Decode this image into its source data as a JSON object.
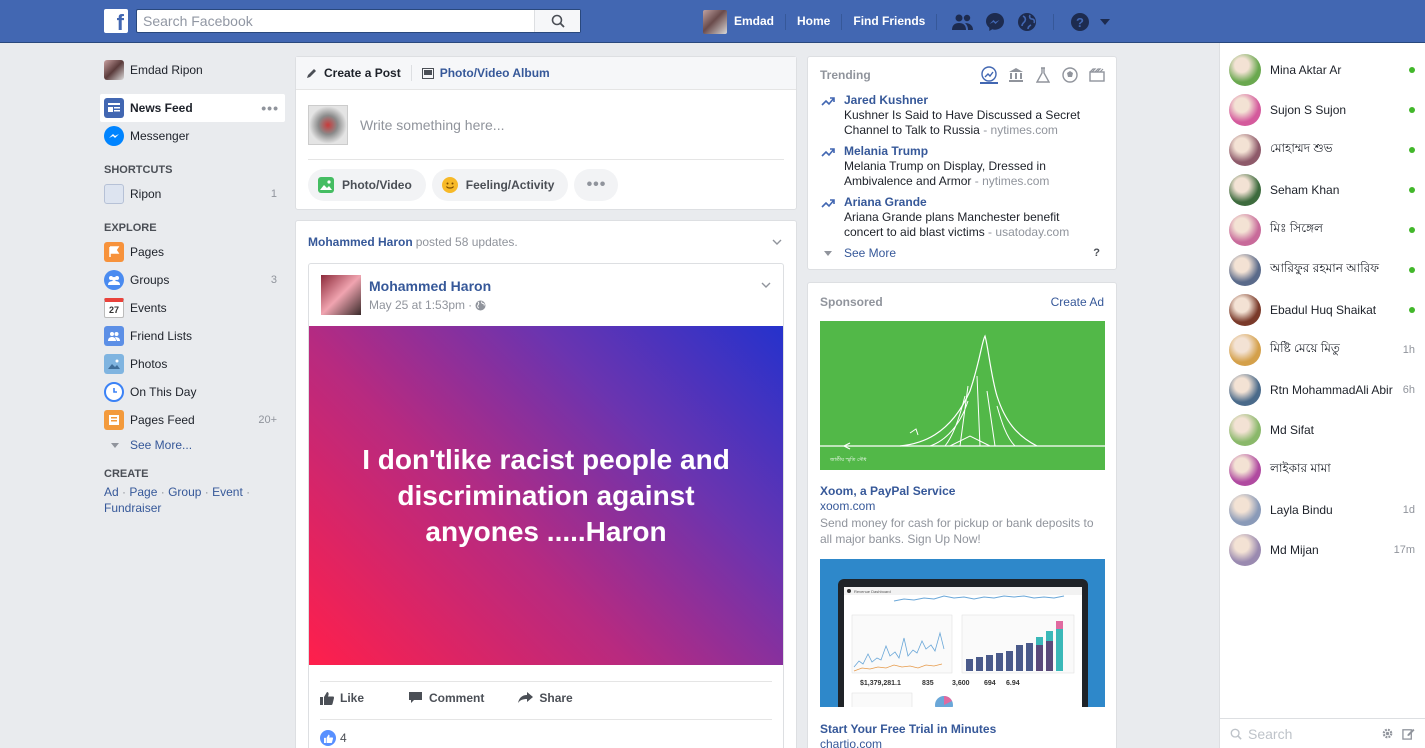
{
  "topbar": {
    "logo": "f",
    "search_placeholder": "Search Facebook",
    "user_name": "Emdad",
    "home": "Home",
    "find_friends": "Find Friends",
    "brand_color": "#4267b2"
  },
  "leftnav": {
    "profile": "Emdad Ripon",
    "news_feed": "News Feed",
    "messenger": "Messenger",
    "shortcuts_heading": "SHORTCUTS",
    "shortcuts": [
      {
        "label": "Ripon",
        "count": "1"
      }
    ],
    "explore_heading": "EXPLORE",
    "explore": [
      {
        "label": "Pages",
        "count": "",
        "icon": "flag-icon"
      },
      {
        "label": "Groups",
        "count": "3",
        "icon": "groups-icon"
      },
      {
        "label": "Events",
        "count": "",
        "icon": "calendar-icon",
        "icon_text": "27"
      },
      {
        "label": "Friend Lists",
        "count": "",
        "icon": "friend-list-icon"
      },
      {
        "label": "Photos",
        "count": "",
        "icon": "photos-icon"
      },
      {
        "label": "On This Day",
        "count": "",
        "icon": "clock-icon"
      },
      {
        "label": "Pages Feed",
        "count": "20+",
        "icon": "pages-feed-icon"
      }
    ],
    "see_more": "See More...",
    "create_heading": "CREATE",
    "create_links": [
      "Ad",
      "Page",
      "Group",
      "Event",
      "Fundraiser"
    ],
    "create_sep": " · "
  },
  "composer": {
    "tab_create": "Create a Post",
    "tab_album": "Photo/Video Album",
    "placeholder": "Write something here...",
    "photo_video": "Photo/Video",
    "feeling": "Feeling/Activity"
  },
  "post": {
    "header_name": "Mohammed Haron",
    "header_text": "posted 58 updates.",
    "author": "Mohammed Haron",
    "time": "May 25 at 1:53pm",
    "dot": "·",
    "banner_text": "I don'tlike racist people and discrimination against anyones .....Haron",
    "like": "Like",
    "comment": "Comment",
    "share": "Share",
    "like_count": "4"
  },
  "trending": {
    "title": "Trending",
    "items": [
      {
        "topic": "Jared Kushner",
        "desc": "Kushner Is Said to Have Discussed a Secret Channel to Talk to Russia",
        "source": "nytimes.com"
      },
      {
        "topic": "Melania Trump",
        "desc": "Melania Trump on Display, Dressed in Ambivalence and Armor",
        "source": "nytimes.com"
      },
      {
        "topic": "Ariana Grande",
        "desc": "Ariana Grande plans Manchester benefit concert to aid blast victims",
        "source": "usatoday.com"
      }
    ],
    "sep": " - ",
    "see_more": "See More",
    "help": "?"
  },
  "sponsored": {
    "title": "Sponsored",
    "create_ad": "Create Ad",
    "ad1_caption": "জাতীয় স্মৃতি সৌধ",
    "ad1_title": "Xoom, a PayPal Service",
    "ad1_domain": "xoom.com",
    "ad1_desc": "Send money for cash for pickup or bank deposits to all major banks. Sign Up Now!",
    "ad2_screen": {
      "title": "Revenue Dashboard",
      "stats": [
        "$1,379,281.1",
        "835",
        "3,600",
        "694",
        "6.94"
      ]
    },
    "ad2_title": "Start Your Free Trial in Minutes",
    "ad2_domain": "chartio.com"
  },
  "chat": {
    "contacts": [
      {
        "name": "Mina Aktar Ar",
        "status": "online",
        "time": "",
        "color": "#6aa84f"
      },
      {
        "name": "Sujon S Sujon",
        "status": "online",
        "time": "",
        "color": "#d45a9c"
      },
      {
        "name": "মোহাম্মদ শুভ",
        "status": "online",
        "time": "",
        "color": "#8e5a6a"
      },
      {
        "name": "Seham Khan",
        "status": "online",
        "time": "",
        "color": "#3d6b3d"
      },
      {
        "name": "মিঃ সিঙ্গেল",
        "status": "online",
        "time": "",
        "color": "#c86a9a"
      },
      {
        "name": "আরিফুর রহমান আরিফ",
        "status": "online",
        "time": "",
        "color": "#5a6a8a"
      },
      {
        "name": "Ebadul Huq Shaikat",
        "status": "online",
        "time": "",
        "color": "#7a3a2a"
      },
      {
        "name": "মিষ্টি মেয়ে মিতু",
        "status": "idle",
        "time": "1h",
        "color": "#d4a04a"
      },
      {
        "name": "Rtn MohammadAli Abir",
        "status": "idle",
        "time": "6h",
        "color": "#4a6a8a"
      },
      {
        "name": "Md Sifat",
        "status": "idle",
        "time": "",
        "color": "#8ab86a"
      },
      {
        "name": "লাইকার মামা",
        "status": "idle",
        "time": "",
        "color": "#b04aa0"
      },
      {
        "name": "Layla Bindu",
        "status": "idle",
        "time": "1d",
        "color": "#8a9ab8"
      },
      {
        "name": "Md Mijan",
        "status": "idle",
        "time": "17m",
        "color": "#9a8ab0"
      }
    ],
    "search_placeholder": "Search"
  }
}
